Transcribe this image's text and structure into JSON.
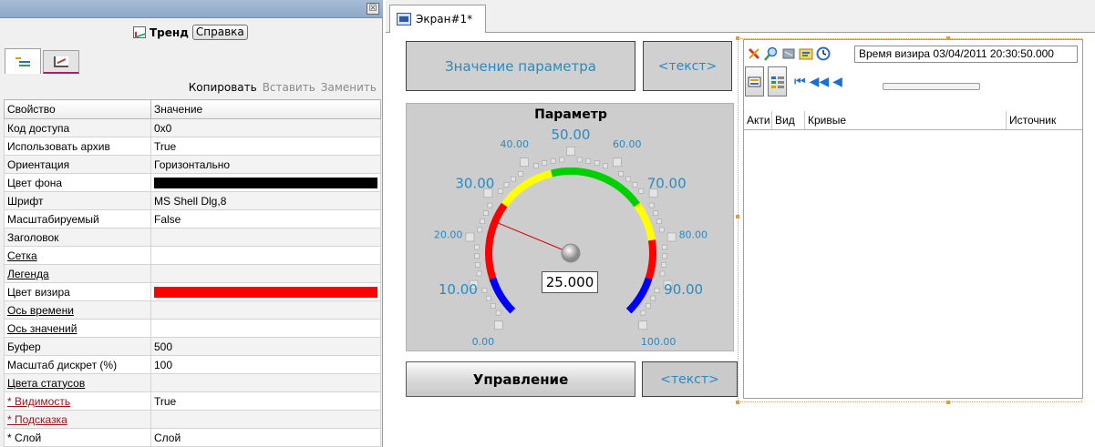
{
  "props_panel": {
    "close_glyph": "☒",
    "title": "Тренд",
    "help_label": "Справка",
    "tabs": [
      {
        "icon": "property-list-icon",
        "active": true
      },
      {
        "icon": "trend-chart-icon",
        "active": false
      }
    ],
    "actions": {
      "copy": "Копировать",
      "paste": "Вставить",
      "replace": "Заменить"
    },
    "columns": [
      "Свойство",
      "Значение"
    ],
    "rows": [
      {
        "key": "Код доступа",
        "value": "0x0"
      },
      {
        "key": "Использовать архив",
        "value": "True"
      },
      {
        "key": "Ориентация",
        "value": "Горизонтально"
      },
      {
        "key": "Цвет фона",
        "value": "",
        "color": "#000000"
      },
      {
        "key": "Шрифт",
        "value": "MS Shell Dlg,8"
      },
      {
        "key": "Масштабируемый",
        "value": "False"
      },
      {
        "key": "Заголовок",
        "value": ""
      },
      {
        "key": "Сетка",
        "value": "",
        "link": true
      },
      {
        "key": "Легенда",
        "value": "",
        "link": true
      },
      {
        "key": "Цвет визира",
        "value": "",
        "color": "#ff0000"
      },
      {
        "key": "Ось времени",
        "value": "",
        "link": true
      },
      {
        "key": "Ось значений",
        "value": "",
        "link": true
      },
      {
        "key": "Буфер",
        "value": "500"
      },
      {
        "key": "Масштаб дискрет (%)",
        "value": "100"
      },
      {
        "key": "Цвета статусов",
        "value": "",
        "link": true
      },
      {
        "key": "* Видимость",
        "value": "True",
        "red": true
      },
      {
        "key": "* Подсказка",
        "value": "",
        "red": true
      },
      {
        "key": "* Слой",
        "value": "Слой"
      }
    ]
  },
  "editor": {
    "tab_label": "Экран#1*",
    "param_button": "Значение параметра",
    "text_button_top": "<текст>",
    "control_button": "Управление",
    "text_button_bottom": "<текст>"
  },
  "gauge": {
    "title": "Параметр",
    "value": 25.0,
    "value_text": "25.000",
    "min": 0,
    "max": 100,
    "tick_labels": [
      "0.00",
      "10.00",
      "20.00",
      "30.00",
      "40.00",
      "50.00",
      "60.00",
      "70.00",
      "80.00",
      "90.00",
      "100.00"
    ],
    "zones": [
      {
        "from": 0,
        "to": 10,
        "color": "#0000ff"
      },
      {
        "from": 10,
        "to": 30,
        "color": "#ff0000"
      },
      {
        "from": 30,
        "to": 45,
        "color": "#ffff00"
      },
      {
        "from": 45,
        "to": 70,
        "color": "#00d000"
      },
      {
        "from": 70,
        "to": 80,
        "color": "#ffff00"
      },
      {
        "from": 80,
        "to": 90,
        "color": "#ff0000"
      },
      {
        "from": 90,
        "to": 100,
        "color": "#0000ff"
      }
    ],
    "label_color": "#2a8ac0",
    "needle_color": "#cc0000"
  },
  "trend_viewer": {
    "cursor_time": "Время визира 03/04/2011 20:30:50.000",
    "toolbar_icons": [
      "clear-icon",
      "zoom-icon",
      "export-icon",
      "settings-icon",
      "clock-icon"
    ],
    "nav_icons": [
      "go-first-icon",
      "step-back-fast-icon",
      "step-back-icon"
    ],
    "columns": [
      "Акти",
      "Вид",
      "Кривые",
      "Источник"
    ]
  }
}
